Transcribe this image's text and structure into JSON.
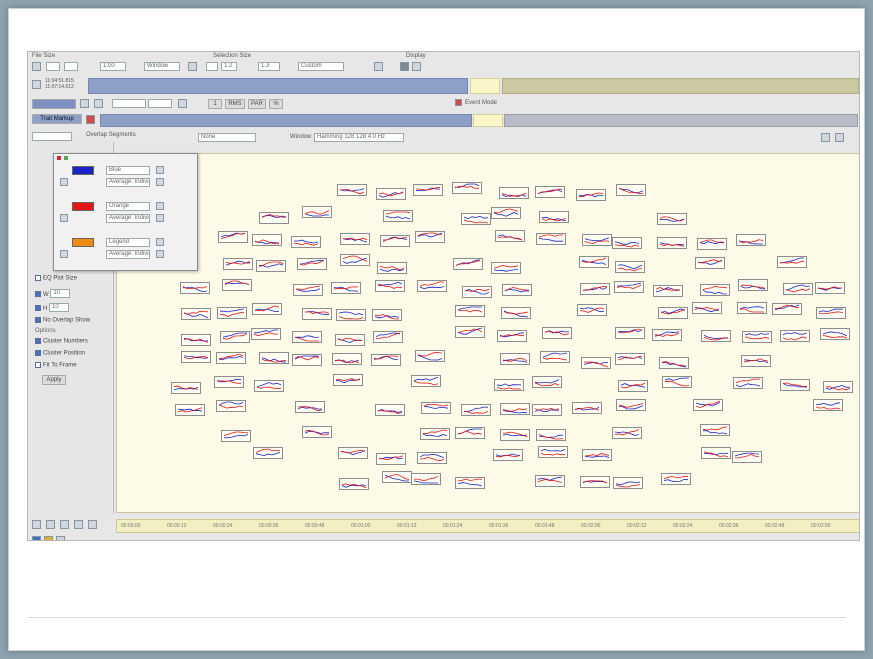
{
  "toolbar": {
    "file_size_label": "File Size",
    "selection_size_label": "Selection Size",
    "display_label": "Display",
    "field_a": "1:00",
    "field_b": "Window",
    "field_c": "1.2",
    "field_d": "1.3",
    "field_e": "Custom",
    "time_start": "11:04:51.815",
    "time_end": "11:07:14.612"
  },
  "row3": {
    "btn_a": "1",
    "btn_b": "RMS",
    "btn_c": "PAR",
    "btn_d": "%",
    "event_mode": "Event Mode",
    "track_label": "Trait Markup"
  },
  "canvas_header": {
    "dropdown_a": "Overlap Segments",
    "dropdown_b": "None",
    "window_label": "Window",
    "window_value": "Hamming 128 128 4.0 Hz"
  },
  "legend": {
    "items": [
      {
        "name": "Blue",
        "color": "#1a22c8",
        "mode": "Average: Individual"
      },
      {
        "name": "Orange",
        "color": "#e61414",
        "mode": "Average: Individual"
      },
      {
        "name": "Legend",
        "color": "#f08a10",
        "mode": "Average: Individual"
      }
    ]
  },
  "side_panel": {
    "plot_size_label": "EQ Plot Size",
    "w_value": "10",
    "h_value": "10",
    "no_overlap": "No Overlap Show",
    "options_label": "Options",
    "cluster_numbers": "Cluster Numbers",
    "cluster_position": "Cluster Position",
    "fit_to_frame": "Fit To Frame",
    "extra": "Apply"
  },
  "strip": {
    "ticks": [
      "00:00:00",
      "00:00:12",
      "00:00:24",
      "00:00:36",
      "00:00:48",
      "00:01:00",
      "00:01:12",
      "00:01:24",
      "00:01:36",
      "00:01:48",
      "00:02:00",
      "00:02:12",
      "00:02:24",
      "00:02:36",
      "00:02:48",
      "00:03:00"
    ]
  }
}
